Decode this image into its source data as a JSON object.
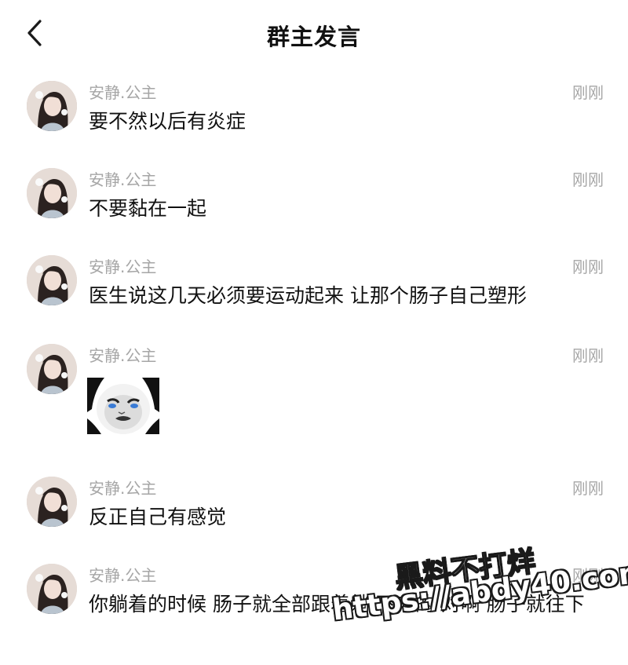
{
  "header": {
    "title": "群主发言",
    "back_icon": "chevron-left-icon"
  },
  "messages": [
    {
      "sender": "安静.公主",
      "time": "刚刚",
      "text": "要不然以后有炎症"
    },
    {
      "sender": "安静.公主",
      "time": "刚刚",
      "text": "不要黏在一起"
    },
    {
      "sender": "安静.公主",
      "time": "刚刚",
      "text": "医生说这几天必须要运动起来 让那个肠子自己塑形"
    },
    {
      "sender": "安静.公主",
      "time": "刚刚",
      "sticker": "panda-face-sticker"
    },
    {
      "sender": "安静.公主",
      "time": "刚刚",
      "text": "反正自己有感觉"
    },
    {
      "sender": "安静.公主",
      "time": "刚刚",
      "text": "你躺着的时候 肠子就全部跟着躺 下来的 对啊 肠子就往下"
    }
  ],
  "watermark": {
    "line1": "黑料不打烊",
    "line2": "https://abdy40.com"
  },
  "colors": {
    "meta_text": "#a6a6a6",
    "body_text": "#111111",
    "background": "#ffffff"
  }
}
